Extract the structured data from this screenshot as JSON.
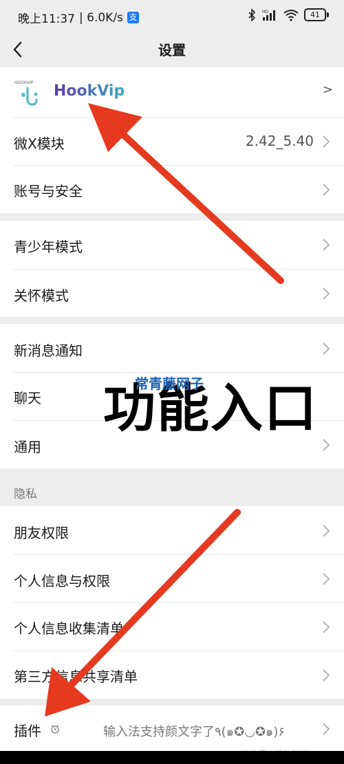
{
  "status_bar": {
    "time": "晚上11:37",
    "speed": "| 6.0K/s",
    "alipay_glyph": "支",
    "battery": "41",
    "hd": "HD"
  },
  "nav": {
    "title": "设置",
    "back_icon": "chevron-left-icon"
  },
  "plugin_header": {
    "logo_caption": "HOOKVIP",
    "brand": "HookVip",
    "chevron": ">"
  },
  "rows": {
    "wechat_module": {
      "label": "微X模块",
      "value": "2.42_5.40"
    },
    "account_security": {
      "label": "账号与安全"
    },
    "youth_mode": {
      "label": "青少年模式"
    },
    "care_mode": {
      "label": "关怀模式"
    },
    "new_message": {
      "label": "新消息通知"
    },
    "chat": {
      "label": "聊天"
    },
    "general": {
      "label": "通用"
    },
    "privacy_section": "隐私",
    "friend_permissions": {
      "label": "朋友权限"
    },
    "personal_info": {
      "label": "个人信息与权限"
    },
    "info_collection": {
      "label": "个人信息收集清单"
    },
    "third_party": {
      "label": "第三方信息共享清单"
    },
    "plugins": {
      "label": "插件",
      "value": "输入法支持颜文字了٩(๑✪◡✪๑)۶"
    }
  },
  "overlay": {
    "headline": "功能入口",
    "watermark": "常青藤网子",
    "footer": "公众号 · 草包科技",
    "arrow_color": "#e53a1f"
  }
}
